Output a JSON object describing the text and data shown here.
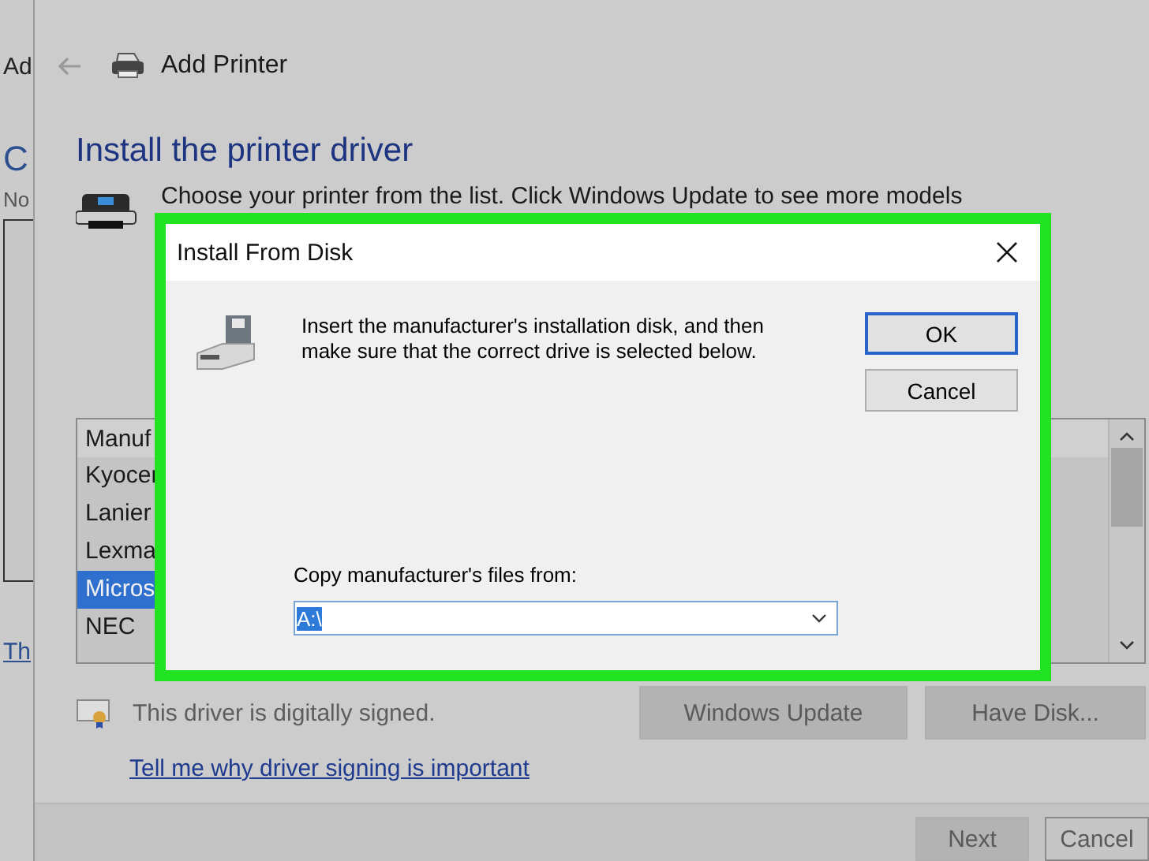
{
  "side_window": {
    "texts": [
      "Ad",
      "C",
      "No"
    ],
    "link": "Th"
  },
  "window": {
    "title": "Add Printer",
    "heading": "Install the printer driver",
    "description": "Choose your printer from the list. Click Windows Update to see more models",
    "list": {
      "header": "Manuf",
      "items": [
        {
          "label": "Kyocer",
          "selected": false
        },
        {
          "label": "Lanier",
          "selected": false
        },
        {
          "label": "Lexma",
          "selected": false
        },
        {
          "label": "Micros",
          "selected": true
        },
        {
          "label": "NEC",
          "selected": false
        }
      ]
    },
    "signature": "This driver is digitally signed.",
    "buttons": [
      "Windows Update",
      "Have Disk..."
    ],
    "link": "Tell me why driver signing is important",
    "footer_buttons": [
      "Next",
      "Cancel"
    ]
  },
  "dialog": {
    "title": "Install From Disk",
    "message": "Insert the manufacturer's installation disk, and then make sure that the correct drive is selected below.",
    "buttons": [
      {
        "label": "OK",
        "default": true
      },
      {
        "label": "Cancel",
        "default": false
      }
    ],
    "path_label": "Copy manufacturer's files from:",
    "path_value": "A:\\"
  }
}
